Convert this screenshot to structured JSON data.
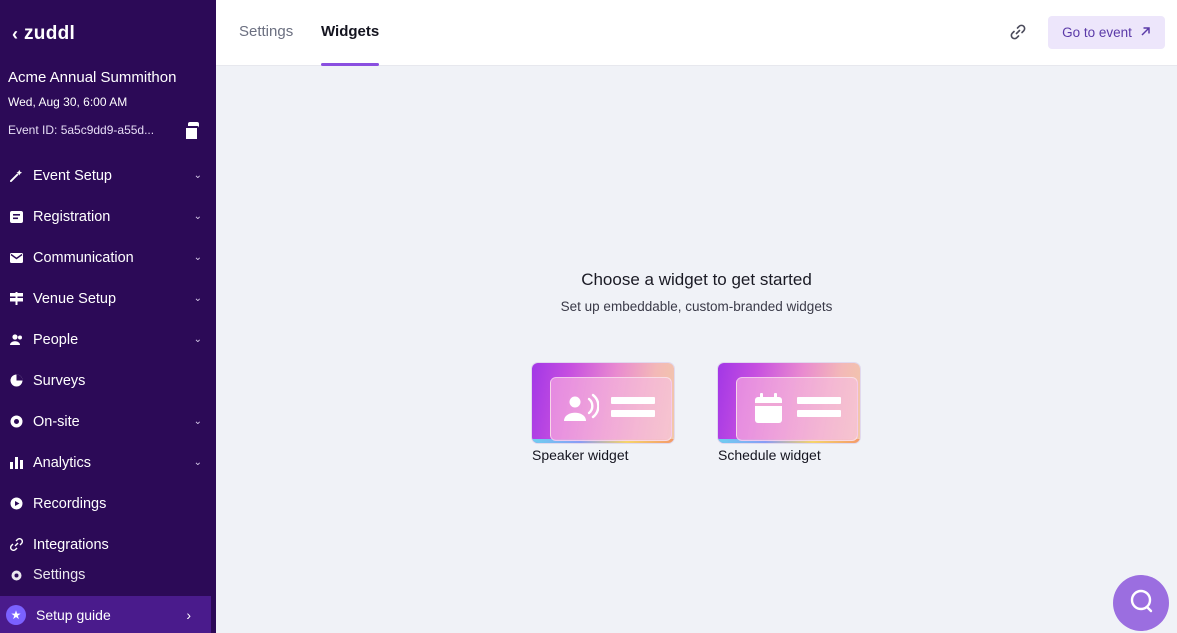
{
  "sidebar": {
    "logo": "zuddl",
    "back_glyph": "‹",
    "event_name": "Acme Annual Summithon",
    "event_date": "Wed, Aug 30, 6:00 AM",
    "event_id": "Event ID: 5a5c9dd9-a55d...",
    "items": [
      {
        "label": "Event Setup",
        "icon": "wand-icon",
        "has_chevron": true
      },
      {
        "label": "Registration",
        "icon": "form-icon",
        "has_chevron": true
      },
      {
        "label": "Communication",
        "icon": "mail-icon",
        "has_chevron": true
      },
      {
        "label": "Venue Setup",
        "icon": "signpost-icon",
        "has_chevron": true
      },
      {
        "label": "People",
        "icon": "people-icon",
        "has_chevron": true
      },
      {
        "label": "Surveys",
        "icon": "pie-icon",
        "has_chevron": false
      },
      {
        "label": "On-site",
        "icon": "onsite-icon",
        "has_chevron": true
      },
      {
        "label": "Analytics",
        "icon": "bar-chart-icon",
        "has_chevron": true
      },
      {
        "label": "Recordings",
        "icon": "play-icon",
        "has_chevron": false
      },
      {
        "label": "Integrations",
        "icon": "link-icon",
        "has_chevron": false
      },
      {
        "label": "Settings",
        "icon": "gear-icon",
        "has_chevron": false
      }
    ],
    "setup_guide": "Setup guide"
  },
  "header": {
    "tabs": [
      {
        "label": "Settings",
        "active": false
      },
      {
        "label": "Widgets",
        "active": true
      }
    ],
    "go_to_event": "Go to event"
  },
  "main": {
    "title": "Choose a widget to get started",
    "subtitle": "Set up embeddable, custom-branded widgets",
    "widgets": [
      {
        "label": "Speaker widget",
        "icon": "speaker-icon"
      },
      {
        "label": "Schedule widget",
        "icon": "calendar-icon"
      }
    ]
  },
  "colors": {
    "sidebar_bg": "#2c0a57",
    "accent": "#8a4fe0",
    "go_button_bg": "#ede6fb",
    "chat_bubble": "#9b6ee0"
  }
}
